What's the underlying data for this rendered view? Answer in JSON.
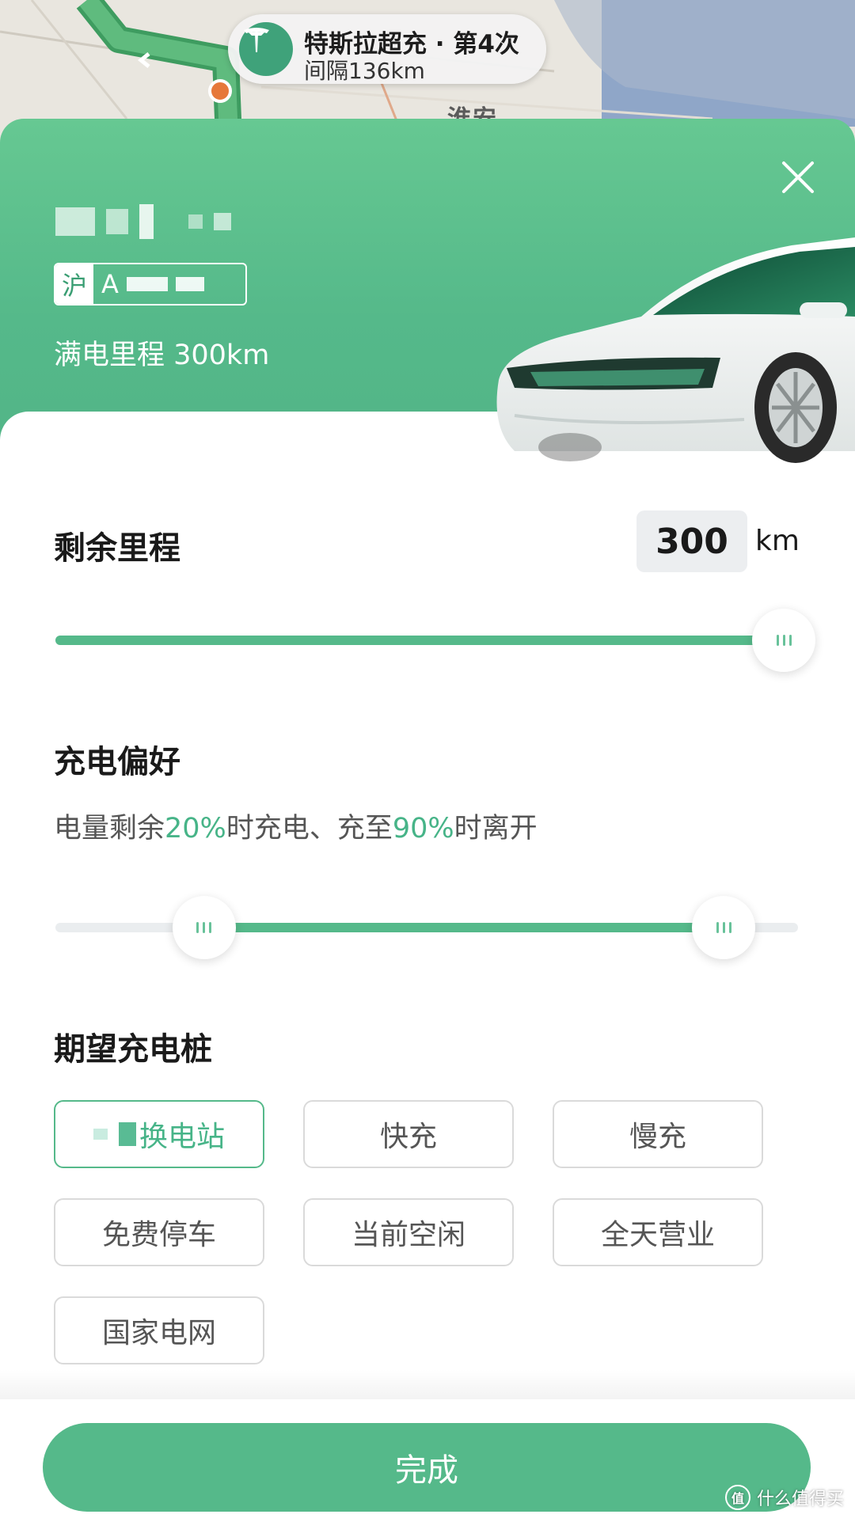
{
  "map": {
    "route_title": "特斯拉超充 · 第4次",
    "route_interval": "间隔136km",
    "place_label": "淮安"
  },
  "vehicle": {
    "plate_province": "沪",
    "plate_prefix": "A",
    "full_range": "满电里程 300km"
  },
  "remaining": {
    "title": "剩余里程",
    "value": "300",
    "unit": "km",
    "slider_fraction": 1.0
  },
  "preference": {
    "title": "充电偏好",
    "desc_prefix": "电量剩余",
    "low_pct": "20%",
    "desc_mid": "时充电、充至",
    "high_pct": "90%",
    "desc_suffix": "时离开",
    "range_low": 0.2,
    "range_high": 0.9
  },
  "chargers": {
    "title": "期望充电桩",
    "options": [
      {
        "label": "换电站",
        "active": true
      },
      {
        "label": "快充",
        "active": false
      },
      {
        "label": "慢充",
        "active": false
      },
      {
        "label": "免费停车",
        "active": false
      },
      {
        "label": "当前空闲",
        "active": false
      },
      {
        "label": "全天营业",
        "active": false
      },
      {
        "label": "国家电网",
        "active": false
      }
    ]
  },
  "footer": {
    "done_label": "完成",
    "watermark": "什么值得买",
    "watermark_logo": "值"
  },
  "colors": {
    "accent": "#55b98a",
    "header_top": "#66c892",
    "text_highlight": "#47b488"
  },
  "icons": {
    "close": "close-icon",
    "tesla": "tesla-logo-icon",
    "slider_grip": "grip-icon"
  }
}
